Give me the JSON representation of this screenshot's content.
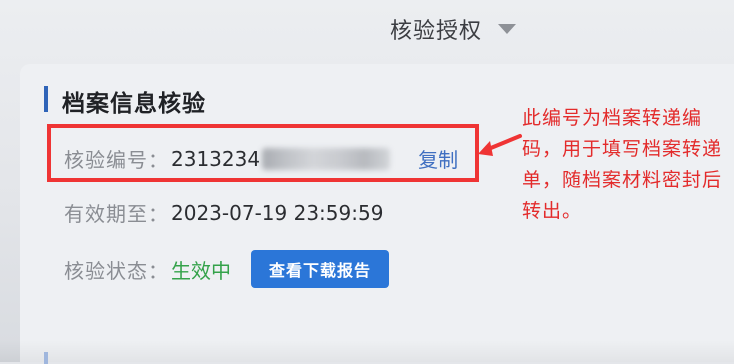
{
  "header": {
    "title": "核验授权",
    "dropdown_icon": "chevron-down-icon"
  },
  "section": {
    "title": "档案信息核验",
    "code": {
      "label": "核验编号：",
      "value_prefix": "2313234",
      "redacted": true,
      "copy_label": "复制"
    },
    "valid_until": {
      "label": "有效期至：",
      "value": "2023-07-19 23:59:59"
    },
    "status": {
      "label": "核验状态：",
      "value": "生效中",
      "button_label": "查看下载报告"
    }
  },
  "annotation": {
    "text": "此编号为档案转递编码，用于填写档案转递单，随档案材料密封后转出。"
  },
  "colors": {
    "annotation_red": "#ef3434",
    "status_green": "#34a24a",
    "link_blue": "#3f6fc1",
    "button_blue": "#2b76d8"
  }
}
